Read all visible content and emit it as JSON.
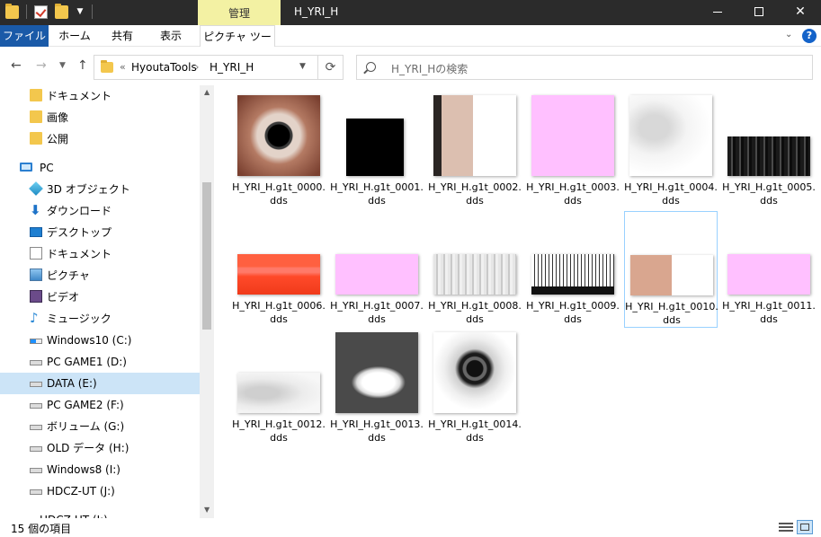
{
  "window": {
    "context_tab": "管理",
    "title": "H_YRI_H",
    "min_label": "",
    "max_label": "",
    "close_label": "✕"
  },
  "ribbon": {
    "tabs": [
      "ファイル",
      "ホーム",
      "共有",
      "表示",
      "ピクチャ ツール"
    ],
    "help": "?"
  },
  "address": {
    "overflow": "«",
    "crumbs": [
      "HyoutaTools",
      "H_YRI_H"
    ],
    "search_placeholder": "H_YRI_Hの検索"
  },
  "sidebar": {
    "items": [
      {
        "label": "ドキュメント",
        "icon": "folder-icon"
      },
      {
        "label": "画像",
        "icon": "folder-icon"
      },
      {
        "label": "公開",
        "icon": "folder-icon"
      },
      {
        "label": "PC",
        "icon": "computer-icon"
      },
      {
        "label": "3D オブジェクト",
        "icon": "3d-objects-icon"
      },
      {
        "label": "ダウンロード",
        "icon": "download-icon"
      },
      {
        "label": "デスクトップ",
        "icon": "desktop-icon"
      },
      {
        "label": "ドキュメント",
        "icon": "documents-icon"
      },
      {
        "label": "ピクチャ",
        "icon": "pictures-icon"
      },
      {
        "label": "ビデオ",
        "icon": "videos-icon"
      },
      {
        "label": "ミュージック",
        "icon": "music-icon"
      },
      {
        "label": "Windows10 (C:)",
        "icon": "windows-drive-icon"
      },
      {
        "label": "PC GAME1 (D:)",
        "icon": "drive-icon"
      },
      {
        "label": "DATA (E:)",
        "icon": "drive-icon",
        "selected": true
      },
      {
        "label": "PC GAME2 (F:)",
        "icon": "drive-icon"
      },
      {
        "label": "ボリューム (G:)",
        "icon": "drive-icon"
      },
      {
        "label": "OLD データ (H:)",
        "icon": "drive-icon"
      },
      {
        "label": "Windows8 (I:)",
        "icon": "drive-icon"
      },
      {
        "label": "HDCZ-UT (J:)",
        "icon": "drive-icon"
      },
      {
        "label": "HDCZ-UT (J:)",
        "icon": "drive-icon"
      }
    ]
  },
  "files": [
    {
      "name": "H_YRI_H.g1t_0000.dds",
      "thumb": "eye-texture-thumbnail"
    },
    {
      "name": "H_YRI_H.g1t_0001.dds",
      "thumb": "black-texture-thumbnail"
    },
    {
      "name": "H_YRI_H.g1t_0002.dds",
      "thumb": "face-texture-thumbnail"
    },
    {
      "name": "H_YRI_H.g1t_0003.dds",
      "thumb": "pink-texture-thumbnail"
    },
    {
      "name": "H_YRI_H.g1t_0004.dds",
      "thumb": "face-normal-thumbnail"
    },
    {
      "name": "H_YRI_H.g1t_0005.dds",
      "thumb": "hair-texture-thumbnail"
    },
    {
      "name": "H_YRI_H.g1t_0006.dds",
      "thumb": "red-gradient-thumbnail"
    },
    {
      "name": "H_YRI_H.g1t_0007.dds",
      "thumb": "pink-texture-thumbnail"
    },
    {
      "name": "H_YRI_H.g1t_0008.dds",
      "thumb": "grey-hair-thumbnail"
    },
    {
      "name": "H_YRI_H.g1t_0009.dds",
      "thumb": "hair-alpha-thumbnail"
    },
    {
      "name": "H_YRI_H.g1t_0010.dds",
      "thumb": "skin-texture-thumbnail",
      "selected": true
    },
    {
      "name": "H_YRI_H.g1t_0011.dds",
      "thumb": "pink-texture-thumbnail"
    },
    {
      "name": "H_YRI_H.g1t_0012.dds",
      "thumb": "light-grey-thumbnail"
    },
    {
      "name": "H_YRI_H.g1t_0013.dds",
      "thumb": "mask-texture-thumbnail"
    },
    {
      "name": "H_YRI_H.g1t_0014.dds",
      "thumb": "eye-highlight-thumbnail"
    }
  ],
  "status": {
    "item_count": "15 個の項目"
  },
  "colors": {
    "titlebar": "#2b2b2b",
    "context_tab": "#f3f1a3",
    "file_tab": "#1a5aa8",
    "selection": "#cce4f7",
    "pink_texture": "#ffc0ff"
  }
}
